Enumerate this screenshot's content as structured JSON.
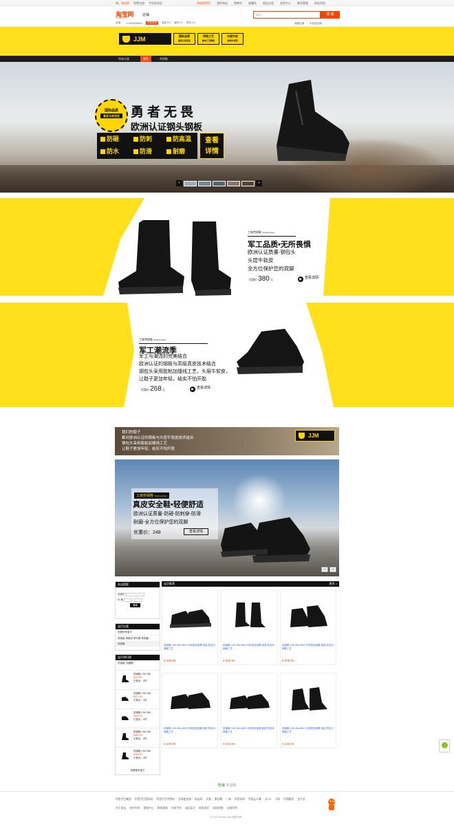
{
  "topbar": {
    "left": [
      "嗨，淘宝网",
      "免费注册",
      "手机逛淘宝"
    ],
    "right": [
      "淘宝网首页",
      "我的淘宝",
      "购物车",
      "收藏夹",
      "商品分类",
      "卖家中心",
      "联系客服",
      "网站导航"
    ]
  },
  "header": {
    "logo": "淘宝网",
    "logo_sub": "Taobao.com",
    "shop_type": "店铺",
    "search_placeholder": "宝贝",
    "search_button": "搜 索",
    "info": [
      "店铺：",
      "JJ1504N3864Z",
      "旺旺在线",
      "描述 5.0",
      "服务 5.0",
      "物流 5.0"
    ],
    "links": [
      "收藏店铺",
      "手机逛店铺"
    ]
  },
  "brand": {
    "logo": "JJM",
    "boxes": [
      {
        "line1": "国际品质",
        "line2": "激发马来西亚"
      },
      {
        "line1": "传统工艺",
        "line2": "欧洲工艺精致"
      },
      {
        "line1": "头层牛皮",
        "line2": "高档牛皮质"
      }
    ]
  },
  "nav": {
    "items": [
      "所有分类",
      "首页",
      "劳保鞋"
    ]
  },
  "hero": {
    "badge_line1": "国际品质",
    "badge_line2": "激发马来西亚",
    "title1": "勇者无畏",
    "title2": "欧洲认证钢头钢板",
    "features": [
      "防砸",
      "防刺",
      "防高温",
      "防水",
      "防滑",
      "耐磨"
    ],
    "cta_line1": "查看",
    "cta_line2": "详情"
  },
  "promo1": {
    "tag": "工装劳保鞋",
    "tag_en": "Tooling shoes",
    "title": "军工品质•无所畏惧",
    "lines": [
      "欧洲认证质量-钢包头",
      "头层牛软皮",
      "全方位保护您的双脚"
    ],
    "price_label": "优惠价",
    "price": "380",
    "unit": "元",
    "view": "查看详情"
  },
  "promo2": {
    "tag": "工装劳保鞋",
    "tag_en": "Tooling shoes",
    "title": "军工潮流季",
    "lines": [
      "军工与潮流的完美结合",
      "欧洲认证的钢板与高级真皮技术结合",
      "钢包头采用胶粘加缝线工艺，头层牛软皮，",
      "让鞋子更加年轻，结实不怕开胶"
    ],
    "price_label": "优惠价",
    "price": "268",
    "unit": "元",
    "view": "查看详情"
  },
  "banner3": {
    "lines": [
      "我们的鞋子",
      "都对欧洲认证的钢板与头层牛软皮技术结合",
      "钢包头采用胶粘加缝线工艺",
      "让鞋子更加年轻，结实不怕开胶"
    ],
    "logo": "JJM"
  },
  "slide": {
    "tag": "工装劳保鞋",
    "tag_en": "Tooling shoes",
    "title": "真皮安全鞋•轻便舒适",
    "line1": "欧洲认证质量-防砸-防刺穿-防滑",
    "line2": "耐磨-全方位保护您的双脚",
    "price": "优惠价：248",
    "button": "查看详情",
    "pager": [
      "01",
      "02"
    ]
  },
  "sidebar": {
    "search_head": "本店搜索",
    "kw_label": "关键字",
    "price_label": "价 格",
    "search_btn": "搜索",
    "cat_head": "宝贝分类",
    "cat_all": "查看所有宝贝",
    "cat_sub": "按销量 按新品 按价格 按收藏",
    "cat_item": "劳保鞋",
    "rank_head": "宝贝排行榜",
    "rank_tabs": [
      "热销量",
      "收藏数"
    ],
    "rank_items": [
      {
        "name": "劳保鞋 JJM 286-",
        "price": "¥370.00",
        "sold": "已售出：0件"
      },
      {
        "name": "劳保鞋 JJM 286-",
        "price": "¥270.00",
        "sold": "已售出：0件"
      },
      {
        "name": "劳保鞋 JJM 286-",
        "price": "¥240.00",
        "sold": "已售出：0件"
      },
      {
        "name": "劳保鞋 JJM 286-",
        "price": "¥380.00",
        "sold": "已售出：0件"
      },
      {
        "name": "劳保鞋 JJM 286-",
        "price": "¥360.00",
        "sold": "已售出：0件"
      }
    ],
    "more": "查看更多宝贝"
  },
  "grid": {
    "head": "宝贝推荐",
    "more": "更多 >",
    "items": [
      {
        "name": "劳保鞋 JJM 286-0813 马来西亚品牌 真皮 防包头 钢板工艺",
        "price": "¥ 269.00"
      },
      {
        "name": "劳保鞋 JJM 286-0803 马来西亚品牌 真皮 防包头 钢板工艺",
        "price": "¥ 340.00"
      },
      {
        "name": "劳保鞋 JJM 286-0810 马来西亚品牌 真皮 防包头 钢板工艺",
        "price": "¥ 200.00"
      },
      {
        "name": "劳保鞋 JJM 286-0806 马来西亚品牌 真皮 防包头 钢板工艺",
        "price": "¥ 240.00"
      },
      {
        "name": "劳保鞋 JJM 286-0809 马来西亚品牌 真皮 防包头 钢板工艺",
        "price": "¥ 230.00"
      },
      {
        "name": "劳保鞋 JJM 286-0811 马来西亚品牌 真皮 防包头 钢板工艺",
        "price": "¥ 220.00"
      }
    ]
  },
  "footer": {
    "wangwang": "旺铺",
    "wangwang_sub": "专业版",
    "row1": [
      "阿里巴巴集团",
      "阿里巴巴国际站",
      "阿里巴巴中国站",
      "全球速卖通",
      "淘宝网",
      "天猫",
      "聚划算",
      "一淘",
      "阿里妈妈",
      "阿里云计算",
      "云OS",
      "万网",
      "中国雅虎",
      "支付宝"
    ],
    "row2": [
      "关于淘宝",
      "合作伙伴",
      "营销中心",
      "联系客服",
      "开放平台",
      "诚征英才",
      "联系我们",
      "网站地图",
      "法律声明"
    ],
    "copyright": "© 2013 Taobao.com 版权所有"
  },
  "colors": {
    "accent": "#ffe01b",
    "brand_red": "#ff4400",
    "dark": "#111111"
  }
}
